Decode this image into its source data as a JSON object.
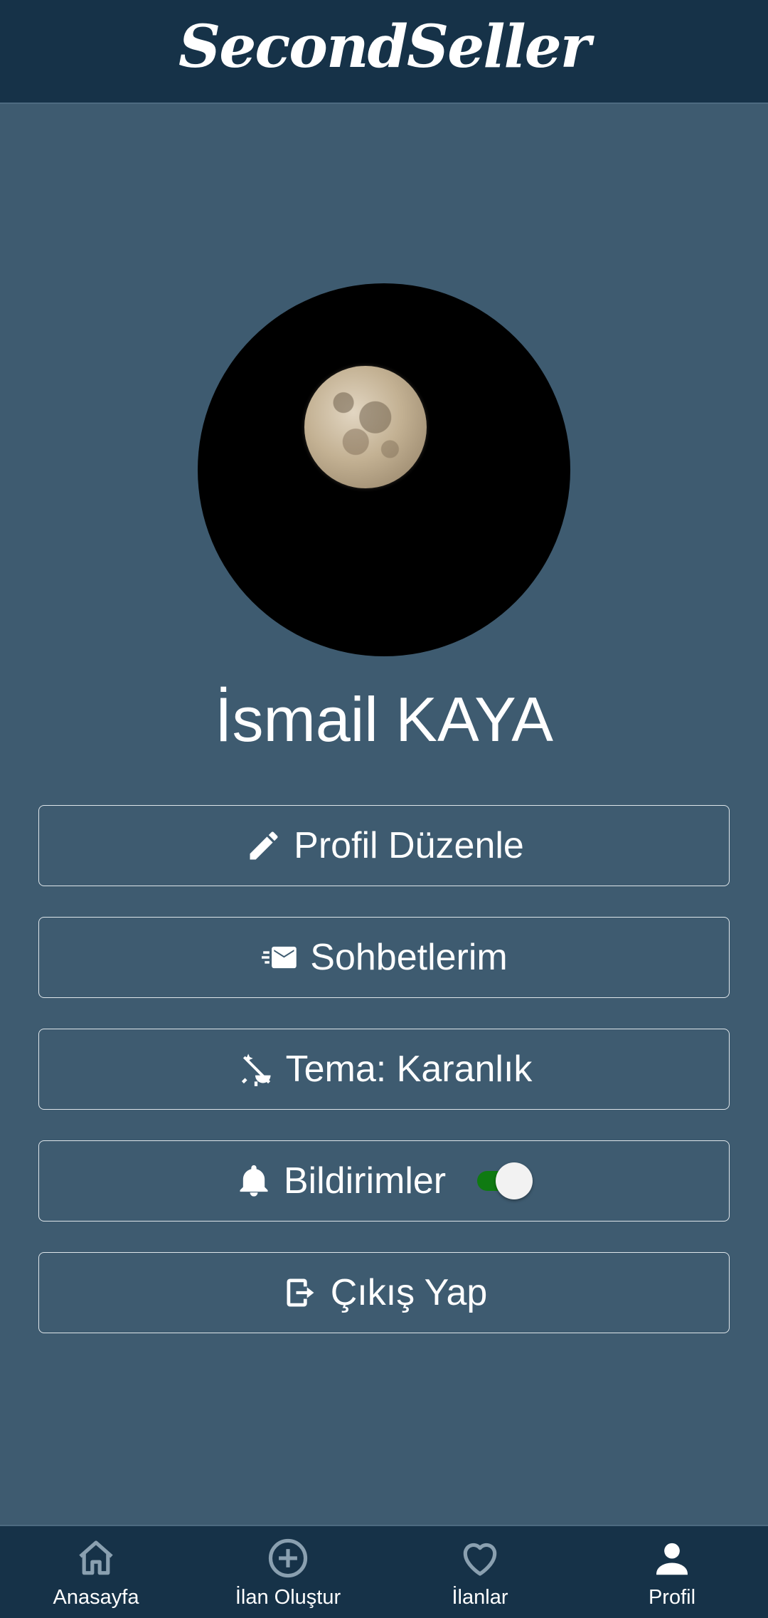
{
  "app": {
    "title": "SecondSeller"
  },
  "profile": {
    "name": "İsmail KAYA"
  },
  "menu": {
    "edit_profile": "Profil Düzenle",
    "chats": "Sohbetlerim",
    "theme": "Tema: Karanlık",
    "notifications": "Bildirimler",
    "notifications_enabled": true,
    "logout": "Çıkış Yap"
  },
  "bottom_nav": {
    "items": [
      {
        "label": "Anasayfa",
        "icon": "home-icon",
        "active": false
      },
      {
        "label": "İlan Oluştur",
        "icon": "add-circle-icon",
        "active": false
      },
      {
        "label": "İlanlar",
        "icon": "heart-icon",
        "active": false
      },
      {
        "label": "Profil",
        "icon": "person-icon",
        "active": true
      }
    ]
  },
  "colors": {
    "background": "#3e5b70",
    "bars": "#163248",
    "toggle_on": "#0f7a12",
    "nav_inactive": "#8aa0b0",
    "nav_active": "#ffffff"
  }
}
